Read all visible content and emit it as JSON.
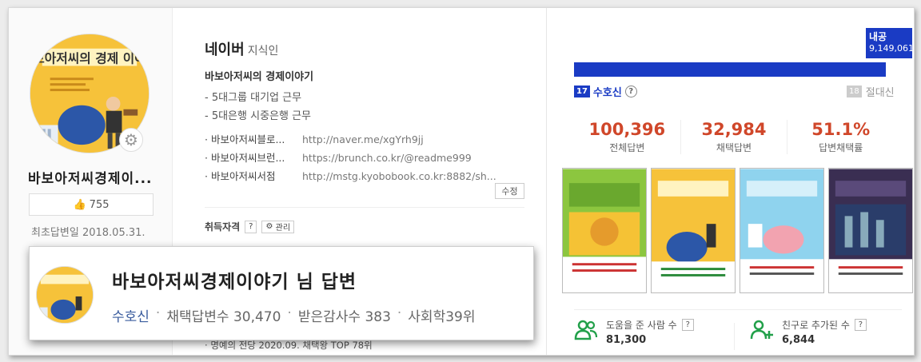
{
  "profile": {
    "nickname": "바보아저씨경제이...",
    "likes": "755",
    "first_answer_label": "최초답변일",
    "first_answer_date": "2018.05.31."
  },
  "intro": {
    "brand": "네이버",
    "brand_sub": "지식인",
    "title": "바보아저씨의 경제이야기",
    "career": [
      "5대그룹 대기업 근무",
      "5대은행 시중은행 근무"
    ],
    "links": [
      {
        "name": "바보아저씨블로...",
        "url": "http://naver.me/xgYrh9jj"
      },
      {
        "name": "바보아저씨브런...",
        "url": "https://brunch.co.kr/@readme999"
      },
      {
        "name": "바보아저씨서점",
        "url": "http://mstg.kyobobook.co.kr:8882/sh..."
      }
    ],
    "edit_label": "수정",
    "qualification_label": "취득자격",
    "qualification_help": "?",
    "manage_label": "관리",
    "honor": "명예의 전당 2020.09. 채택왕 TOP 78위"
  },
  "grade": {
    "current_level_label": "내공",
    "current_points": "9,149,061",
    "progress": 1.0,
    "current_grade_num": "17",
    "current_grade": "수호신",
    "next_grade_num": "18",
    "next_grade": "절대신",
    "accent": "#1a3bc4"
  },
  "stats": [
    {
      "value": "100,396",
      "label": "전체답변"
    },
    {
      "value": "32,984",
      "label": "채택답변"
    },
    {
      "value": "51.1%",
      "label": "답변채택률"
    }
  ],
  "bottom": {
    "helped_label": "도움을 준 사람 수",
    "helped_value": "81,300",
    "friends_label": "친구로 추가된 수",
    "friends_value": "6,844"
  },
  "popup": {
    "title": "바보아저씨경제이야기 님 답변",
    "grade": "수호신",
    "chosen_label": "채택답변수",
    "chosen_value": "30,470",
    "thanks_label": "받은감사수",
    "thanks_value": "383",
    "rank_label": "사회학39위"
  }
}
